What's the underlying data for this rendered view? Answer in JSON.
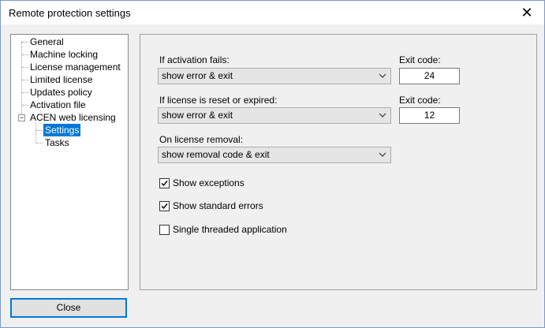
{
  "window": {
    "title": "Remote protection settings"
  },
  "tree": {
    "items": [
      {
        "label": "General"
      },
      {
        "label": "Machine locking"
      },
      {
        "label": "License management"
      },
      {
        "label": "Limited license"
      },
      {
        "label": "Updates policy"
      },
      {
        "label": "Activation file"
      },
      {
        "label": "ACEN web licensing"
      }
    ],
    "children": [
      {
        "label": "Settings",
        "selected": true
      },
      {
        "label": "Tasks"
      }
    ]
  },
  "settings": {
    "activation_fails": {
      "label": "If activation fails:",
      "value": "show error & exit",
      "exit_label": "Exit code:",
      "exit_value": "24"
    },
    "license_reset": {
      "label": "If license is reset or expired:",
      "value": "show error & exit",
      "exit_label": "Exit code:",
      "exit_value": "12"
    },
    "license_removal": {
      "label": "On license removal:",
      "value": "show removal code & exit"
    },
    "checkboxes": [
      {
        "label": "Show exceptions",
        "checked": true
      },
      {
        "label": "Show standard errors",
        "checked": true
      },
      {
        "label": "Single threaded application",
        "checked": false
      }
    ]
  },
  "buttons": {
    "close": "Close"
  },
  "colors": {
    "selection": "#0078d7",
    "border": "#7a9ac7"
  }
}
